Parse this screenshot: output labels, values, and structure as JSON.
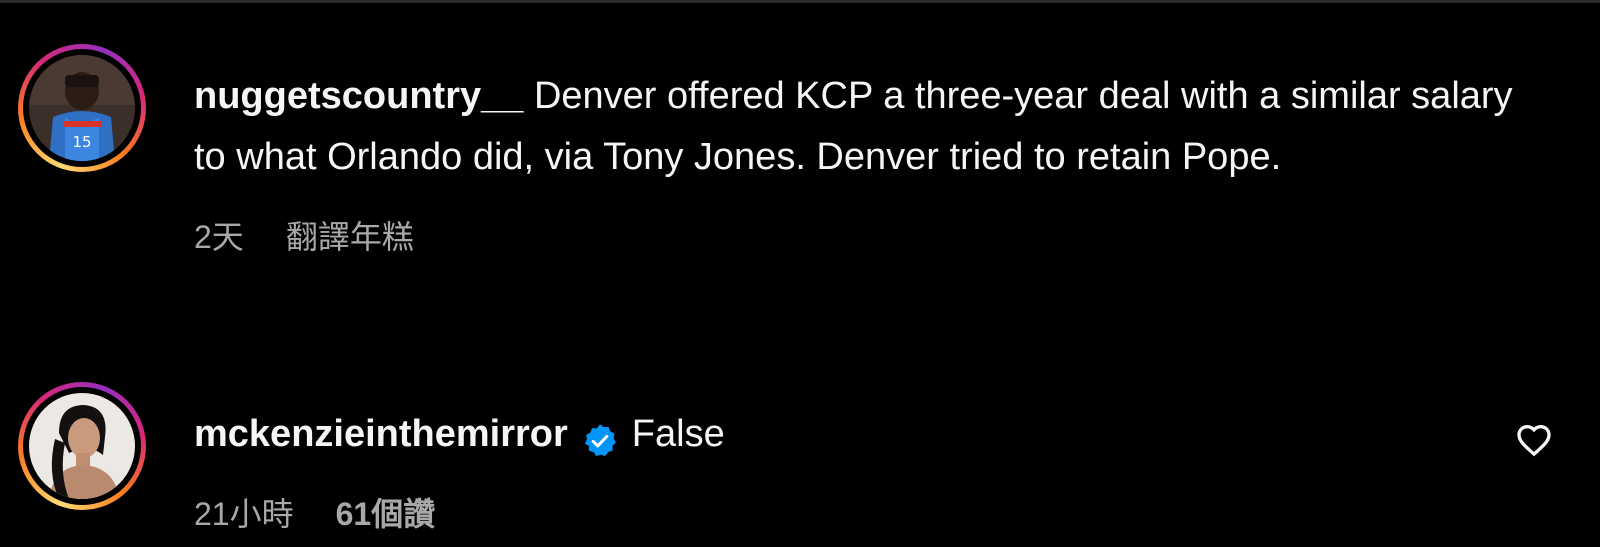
{
  "comments": [
    {
      "username": "nuggetscountry__",
      "text": "Denver offered KCP a three-year deal with a similar salary to what Orlando did, via Tony Jones. Denver tried to retain Pope.",
      "time": "2天",
      "translate_label": "翻譯年糕",
      "avatar": "basketball-player-avatar",
      "jersey_number": "15"
    },
    {
      "username": "mckenzieinthemirror",
      "verified": true,
      "text": "False",
      "time": "21小時",
      "likes": "61個讚",
      "avatar": "woman-portrait-avatar"
    }
  ],
  "colors": {
    "background": "#000000",
    "text_primary": "#f5f5f5",
    "text_secondary": "#a8a8a8",
    "verified_blue": "#0095f6"
  },
  "icons": {
    "verified": "verified-badge-icon",
    "like": "heart-outline-icon"
  }
}
